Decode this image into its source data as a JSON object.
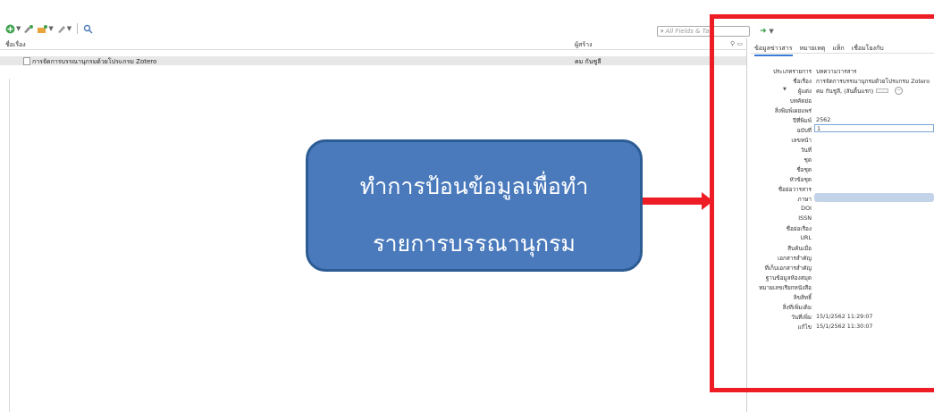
{
  "toolbar": {
    "icons": [
      "new-item-icon",
      "add-by-identifier-icon",
      "attachment-icon",
      "note-icon",
      "locate-icon"
    ]
  },
  "search": {
    "placeholder": "All Fields & Tag"
  },
  "columns": {
    "title": "ชื่อเรื่อง",
    "creator": "ผู้สร้าง"
  },
  "items": [
    {
      "title": "การจัดการบรรณานุกรมด้วยโปรแกรม Zotero",
      "creator": "คม กันชูลี"
    }
  ],
  "right_panel": {
    "tabs": [
      "ข้อมูลข่าวสาร",
      "หมายเหตุ",
      "แท็ก",
      "เชื่อมโยงกับ"
    ],
    "fields": [
      {
        "label": "ประเภทรายการ",
        "value": "บทความวารสาร"
      },
      {
        "label": "ชื่อเรื่อง",
        "value": "การจัดการบรรณานุกรมด้วยโปรแกรม Zotero"
      },
      {
        "label": "ผู้แต่ง",
        "value": "คม กันชูลี, (ลันติ้นแรก)"
      },
      {
        "label": "บทคัดย่อ",
        "value": ""
      },
      {
        "label": "สิ่งพิมพ์เผยแพร่",
        "value": ""
      },
      {
        "label": "ปีที่พิมพ์",
        "value": "2562"
      },
      {
        "label": "ฉบับที่",
        "value": "1"
      },
      {
        "label": "เลขหน้า",
        "value": ""
      },
      {
        "label": "วันที่",
        "value": ""
      },
      {
        "label": "ชุด",
        "value": ""
      },
      {
        "label": "ชื่อชุด",
        "value": ""
      },
      {
        "label": "หัวข้อชุด",
        "value": ""
      },
      {
        "label": "ชื่อย่อวารสาร",
        "value": ""
      },
      {
        "label": "ภาษา",
        "value": ""
      },
      {
        "label": "DOI",
        "value": ""
      },
      {
        "label": "ISSN",
        "value": ""
      },
      {
        "label": "ชื่อย่อเรื่อง",
        "value": ""
      },
      {
        "label": "URL",
        "value": ""
      },
      {
        "label": "สืบค้นเมื่อ",
        "value": ""
      },
      {
        "label": "เอกสารสำคัญ",
        "value": ""
      },
      {
        "label": "ที่เก็บเอกสารสำคัญ",
        "value": ""
      },
      {
        "label": "ฐานข้อมูลห้องสมุด",
        "value": ""
      },
      {
        "label": "หมายเลขเรียกหนังสือ",
        "value": ""
      },
      {
        "label": "ลิขสิทธิ์",
        "value": ""
      },
      {
        "label": "สิ่งที่เพิ่มเติม",
        "value": ""
      },
      {
        "label": "วันที่เพิ่ม",
        "value": "15/1/2562 11:29:07"
      },
      {
        "label": "แก้ไข",
        "value": "15/1/2562 11:30:07"
      }
    ]
  },
  "callout": {
    "line1": "ทำการป้อนข้อมูลเพื่อทำ",
    "line2": "รายการบรรณานุกรม",
    "color": "#4a7abc"
  },
  "annotation_color": "#ee1c24"
}
